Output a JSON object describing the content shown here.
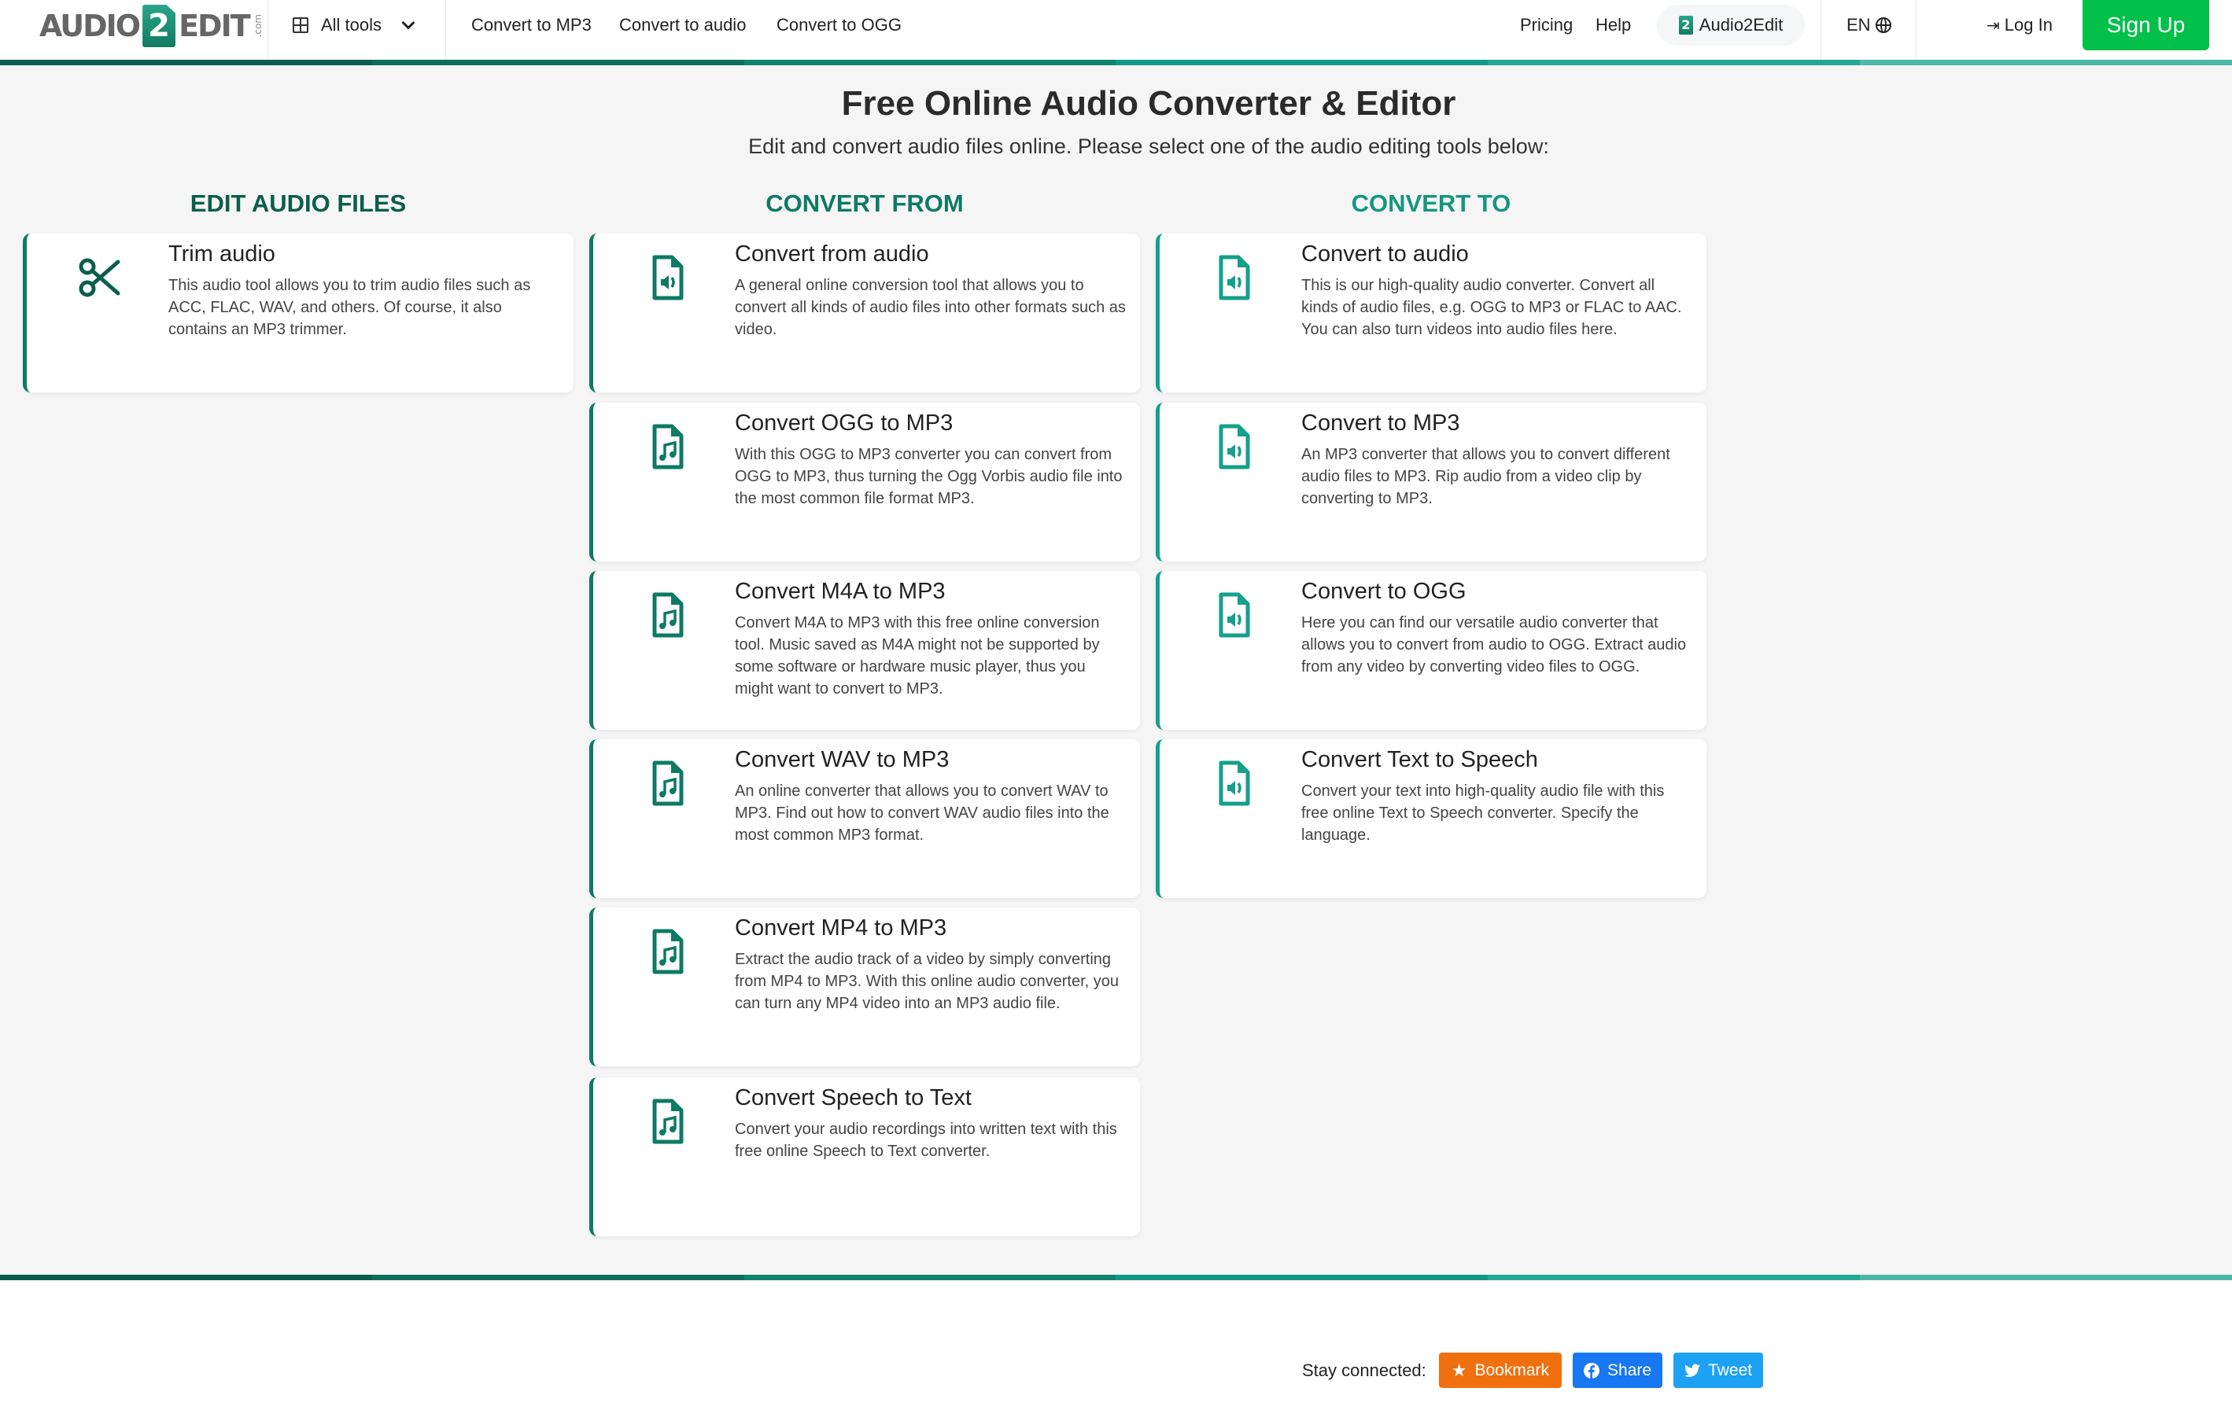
{
  "header": {
    "logo": {
      "left": "AUDIO",
      "mid": "2",
      "right": "EDIT",
      "suffix": ".com"
    },
    "all_tools_label": "All tools",
    "quick_links": [
      "Convert to MP3",
      "Convert to audio",
      "Convert to OGG"
    ],
    "pricing_label": "Pricing",
    "help_label": "Help",
    "brand_pill_label": "Audio2Edit",
    "brand_pill_badge": "2",
    "language_label": "EN",
    "login_label": "Log In",
    "signup_label": "Sign Up"
  },
  "colors": {
    "accent_dark": "#0e7a63",
    "accent_teal": "#14a08a",
    "heading_dark": "#0b5e4a",
    "heading_teal": "#14967f",
    "signup_green": "#03c04a",
    "bookmark_orange": "#f07010",
    "facebook_blue": "#1877f2",
    "twitter_blue": "#1da1f2",
    "stripe": [
      "#0b5e4f",
      "#0d6e5e",
      "#0e8470",
      "#11988a",
      "#22a898",
      "#4db8aa"
    ]
  },
  "main": {
    "title": "Free Online Audio Converter & Editor",
    "subtitle": "Edit and convert audio files online. Please select one of the audio editing tools below:",
    "columns": [
      {
        "heading": "EDIT AUDIO FILES",
        "cards": [
          {
            "icon": "scissors-icon",
            "title": "Trim audio",
            "description": "This audio tool allows you to trim audio files such as ACC, FLAC, WAV, and others. Of course, it also contains an MP3 trimmer."
          }
        ]
      },
      {
        "heading": "CONVERT FROM",
        "cards": [
          {
            "icon": "file-audio-icon",
            "title": "Convert from audio",
            "description": "A general online conversion tool that allows you to convert all kinds of audio files into other formats such as video."
          },
          {
            "icon": "file-music-icon",
            "title": "Convert OGG to MP3",
            "description": "With this OGG to MP3 converter you can convert from OGG to MP3, thus turning the Ogg Vorbis audio file into the most common file format MP3."
          },
          {
            "icon": "file-music-icon",
            "title": "Convert M4A to MP3",
            "description": "Convert M4A to MP3 with this free online conversion tool. Music saved as M4A might not be supported by some software or hardware music player, thus you might want to convert to MP3."
          },
          {
            "icon": "file-music-icon",
            "title": "Convert WAV to MP3",
            "description": "An online converter that allows you to convert WAV to MP3. Find out how to convert WAV audio files into the most common MP3 format."
          },
          {
            "icon": "file-music-icon",
            "title": "Convert MP4 to MP3",
            "description": "Extract the audio track of a video by simply converting from MP4 to MP3. With this online audio converter, you can turn any MP4 video into an MP3 audio file."
          },
          {
            "icon": "file-music-icon",
            "title": "Convert Speech to Text",
            "description": "Convert your audio recordings into written text with this free online Speech to Text converter."
          }
        ]
      },
      {
        "heading": "CONVERT TO",
        "cards": [
          {
            "icon": "file-audio-icon",
            "title": "Convert to audio",
            "description": "This is our high-quality audio converter. Convert all kinds of audio files, e.g. OGG to MP3 or FLAC to AAC. You can also turn videos into audio files here."
          },
          {
            "icon": "file-audio-icon",
            "title": "Convert to MP3",
            "description": "An MP3 converter that allows you to convert different audio files to MP3. Rip audio from a video clip by converting to MP3."
          },
          {
            "icon": "file-audio-icon",
            "title": "Convert to OGG",
            "description": "Here you can find our versatile audio converter that allows you to convert from audio to OGG. Extract audio from any video by converting video files to OGG."
          },
          {
            "icon": "file-audio-icon",
            "title": "Convert Text to Speech",
            "description": "Convert your text into high-quality audio file with this free online Text to Speech converter. Specify the language."
          }
        ]
      }
    ]
  },
  "footer": {
    "stay_connected_label": "Stay connected:",
    "bookmark_label": "Bookmark",
    "share_label": "Share",
    "tweet_label": "Tweet"
  }
}
